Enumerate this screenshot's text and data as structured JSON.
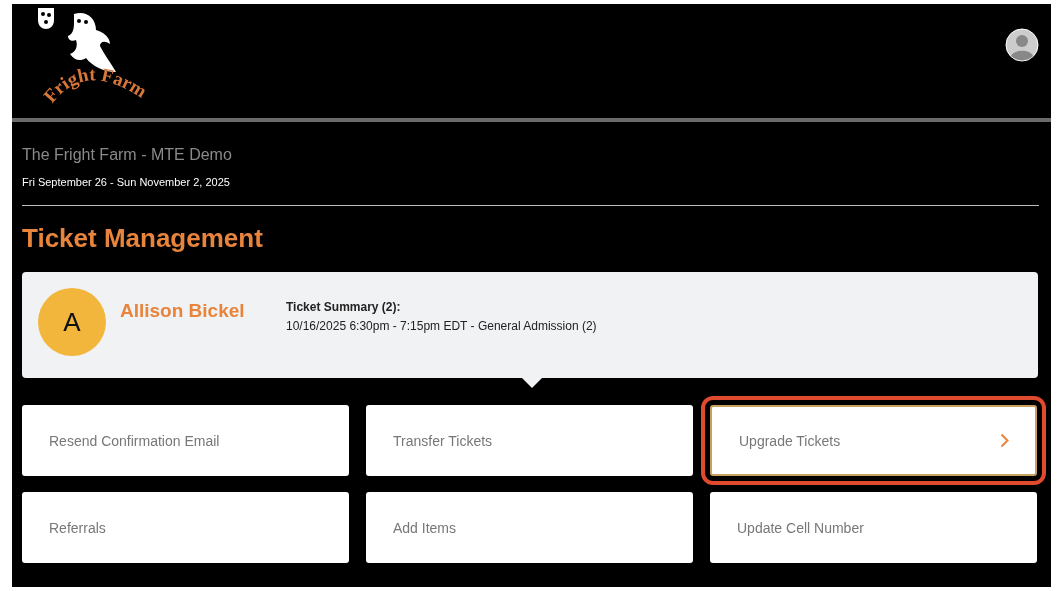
{
  "logo": {
    "text": "Fright Farm"
  },
  "event": {
    "title": "The Fright Farm - MTE Demo",
    "dates": "Fri September 26 - Sun November 2, 2025"
  },
  "heading": "Ticket Management",
  "customer": {
    "initial": "A",
    "name": "Allison Bickel",
    "summary_title": "Ticket Summary (2):",
    "summary_line": "10/16/2025 6:30pm - 7:15pm EDT - General Admission (2)"
  },
  "actions": [
    {
      "label": "Resend Confirmation Email",
      "selected": false
    },
    {
      "label": "Transfer Tickets",
      "selected": false
    },
    {
      "label": "Upgrade Tickets",
      "selected": true
    },
    {
      "label": "Referrals",
      "selected": false
    },
    {
      "label": "Add Items",
      "selected": false
    },
    {
      "label": "Update Cell Number",
      "selected": false
    }
  ]
}
